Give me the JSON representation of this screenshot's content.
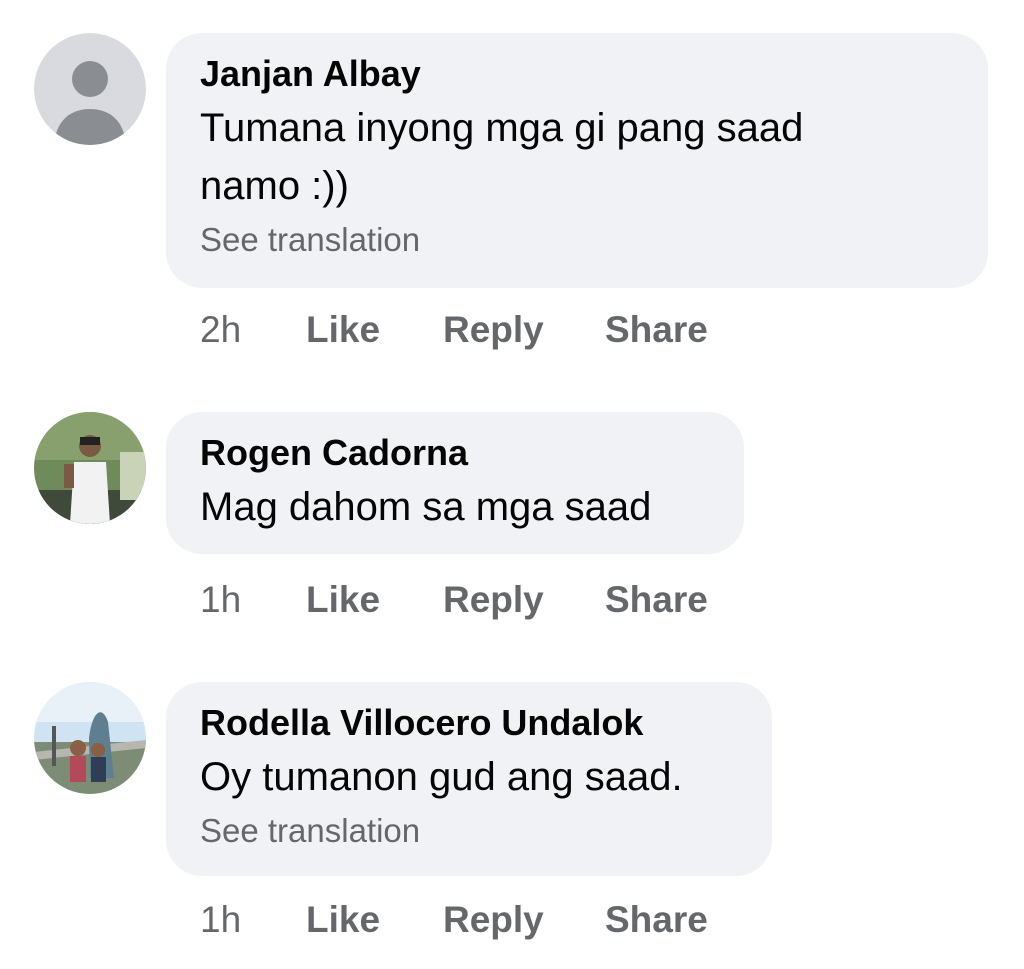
{
  "comments": [
    {
      "author": "Janjan Albay",
      "text_lines": [
        "Tumana inyong mga gi pang saad",
        "namo :))"
      ],
      "see_translation": "See translation",
      "time": "2h",
      "avatar": "default-avatar",
      "actions": {
        "like": "Like",
        "reply": "Reply",
        "share": "Share"
      }
    },
    {
      "author": "Rogen Cadorna",
      "text_lines": [
        "Mag dahom sa mga saad"
      ],
      "see_translation": "",
      "time": "1h",
      "avatar": "photo-avatar",
      "actions": {
        "like": "Like",
        "reply": "Reply",
        "share": "Share"
      }
    },
    {
      "author": "Rodella Villocero Undalok",
      "text_lines": [
        "Oy tumanon gud ang saad."
      ],
      "see_translation": "See translation",
      "time": "1h",
      "avatar": "photo-avatar",
      "actions": {
        "like": "Like",
        "reply": "Reply",
        "share": "Share"
      }
    }
  ],
  "colors": {
    "bubble": "#f0f2f5",
    "primary_text": "#050505",
    "secondary_text": "#65676b"
  }
}
